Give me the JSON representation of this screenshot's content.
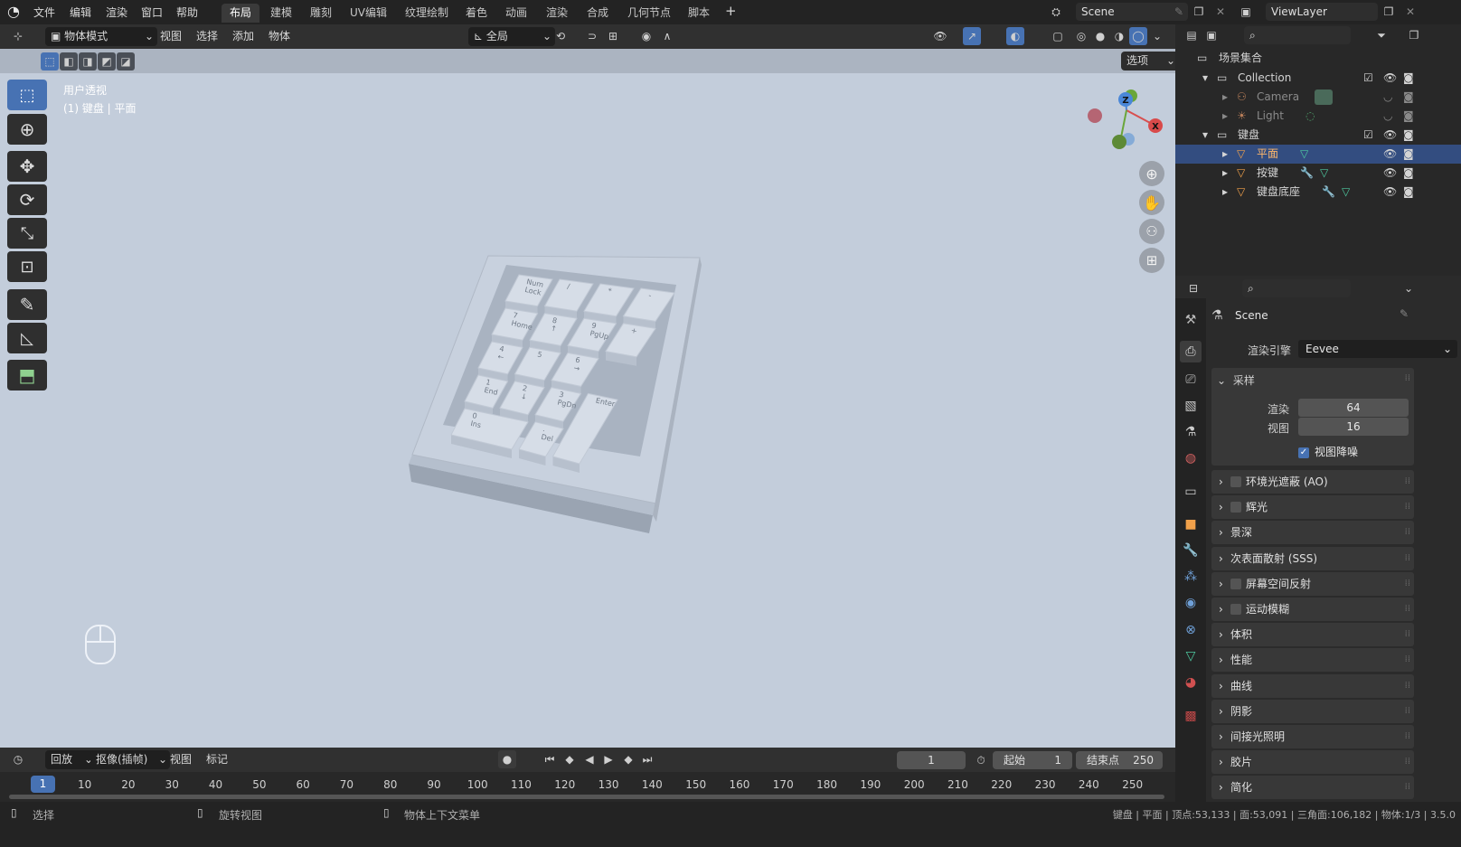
{
  "topbar": {
    "menus": [
      "文件",
      "编辑",
      "渲染",
      "窗口",
      "帮助"
    ],
    "workspaces": [
      "布局",
      "建模",
      "雕刻",
      "UV编辑",
      "纹理绘制",
      "着色",
      "动画",
      "渲染",
      "合成",
      "几何节点",
      "脚本"
    ],
    "active_workspace": "布局",
    "add_tab": "+",
    "scene_name": "Scene",
    "view_layer": "ViewLayer"
  },
  "viewport_header": {
    "mode": "物体模式",
    "menus": [
      "视图",
      "选择",
      "添加",
      "物体"
    ],
    "transform_orientation": "全局",
    "options": "选项"
  },
  "viewport": {
    "view_name": "用户透视",
    "object_info": "(1) 键盘 | 平面",
    "keycaps": [
      {
        "label": "Num\nLock"
      },
      {
        "label": "/"
      },
      {
        "label": "*"
      },
      {
        "label": "-"
      },
      {
        "label": "7\nHome"
      },
      {
        "label": "8\n↑"
      },
      {
        "label": "9\nPgUp"
      },
      {
        "label": "+"
      },
      {
        "label": "4\n←"
      },
      {
        "label": "5"
      },
      {
        "label": "6\n→"
      },
      {
        "label": "1\nEnd"
      },
      {
        "label": "2\n↓"
      },
      {
        "label": "3\nPgDn"
      },
      {
        "label": "Enter"
      },
      {
        "label": "0\nIns"
      },
      {
        "label": ".\nDel"
      }
    ],
    "gizmo_axes": [
      "Z",
      "X"
    ]
  },
  "outliner": {
    "root": "场景集合",
    "items": [
      {
        "label": "Collection",
        "level": 1
      },
      {
        "label": "Camera",
        "level": 2
      },
      {
        "label": "Light",
        "level": 2
      },
      {
        "label": "键盘",
        "level": 1
      },
      {
        "label": "平面",
        "level": 2,
        "selected": true
      },
      {
        "label": "按键",
        "level": 2
      },
      {
        "label": "键盘底座",
        "level": 2
      }
    ]
  },
  "properties": {
    "scene": "Scene",
    "render_engine_label": "渲染引擎",
    "render_engine": "Eevee",
    "sampling": {
      "title": "采样",
      "render_label": "渲染",
      "render_value": "64",
      "viewport_label": "视图",
      "viewport_value": "16",
      "denoise_label": "视图降噪"
    },
    "panels": [
      {
        "label": "环境光遮蔽 (AO)",
        "checkbox": true
      },
      {
        "label": "辉光",
        "checkbox": true
      },
      {
        "label": "景深",
        "checkbox": false
      },
      {
        "label": "次表面散射 (SSS)",
        "checkbox": false
      },
      {
        "label": "屏幕空间反射",
        "checkbox": true
      },
      {
        "label": "运动模糊",
        "checkbox": true
      },
      {
        "label": "体积",
        "checkbox": false
      },
      {
        "label": "性能",
        "checkbox": false
      },
      {
        "label": "曲线",
        "checkbox": false
      },
      {
        "label": "阴影",
        "checkbox": false
      },
      {
        "label": "间接光照明",
        "checkbox": false
      },
      {
        "label": "胶片",
        "checkbox": false
      },
      {
        "label": "简化",
        "checkbox": false
      }
    ]
  },
  "timeline": {
    "playback": "回放",
    "keying": "抠像(插帧)",
    "view": "视图",
    "marker": "标记",
    "current_frame": "1",
    "start_label": "起始",
    "start_value": "1",
    "end_label": "结束点",
    "end_value": "250",
    "ruler_current": "1",
    "ruler": [
      "10",
      "20",
      "30",
      "40",
      "50",
      "60",
      "70",
      "80",
      "90",
      "100",
      "110",
      "120",
      "130",
      "140",
      "150",
      "160",
      "170",
      "180",
      "190",
      "200",
      "210",
      "220",
      "230",
      "240",
      "250"
    ]
  },
  "statusbar": {
    "select": "选择",
    "rotate": "旋转视图",
    "context_menu": "物体上下文菜单",
    "stats": "键盘 | 平面 | 顶点:53,133 | 面:53,091 | 三角面:106,182 | 物体:1/3 | 3.5.0"
  }
}
